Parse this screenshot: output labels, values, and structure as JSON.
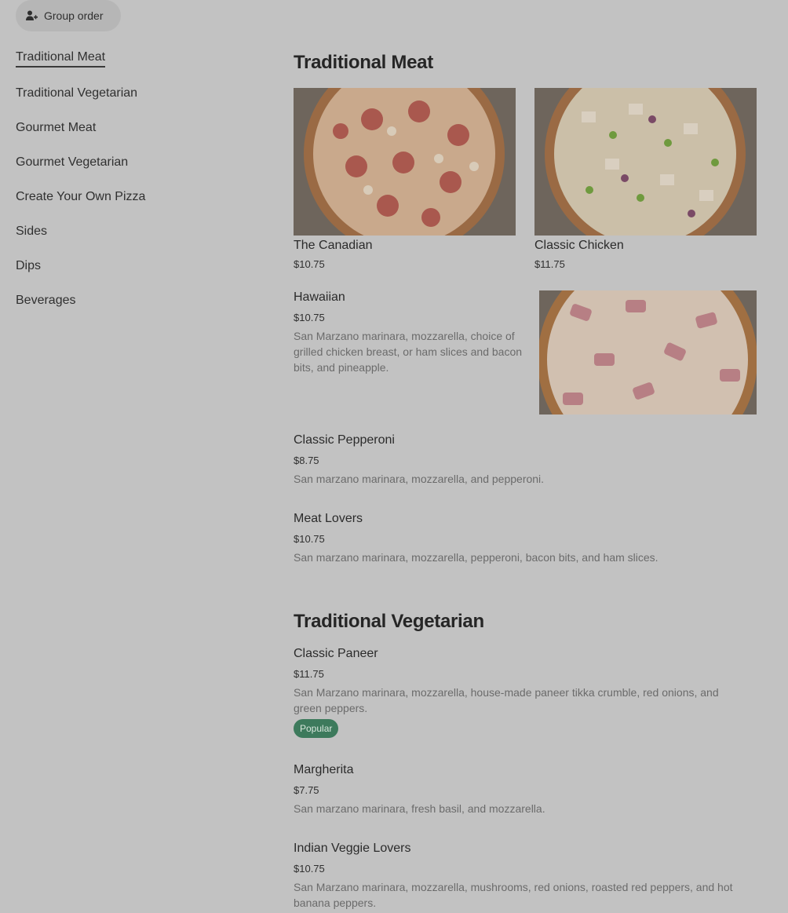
{
  "header": {
    "group_order_label": "Group order",
    "group_order_icon": "add-person-icon"
  },
  "sidebar": {
    "items": [
      {
        "label": "Traditional Meat",
        "active": true
      },
      {
        "label": "Traditional Vegetarian"
      },
      {
        "label": "Gourmet Meat"
      },
      {
        "label": "Gourmet Vegetarian"
      },
      {
        "label": "Create Your Own Pizza"
      },
      {
        "label": "Sides"
      },
      {
        "label": "Dips"
      },
      {
        "label": "Beverages"
      }
    ]
  },
  "sections": [
    {
      "title": "Traditional Meat",
      "items": [
        {
          "name": "The Canadian",
          "price": "$10.75"
        },
        {
          "name": "Classic Chicken",
          "price": "$11.75"
        },
        {
          "name": "Hawaiian",
          "price": "$10.75",
          "description": "San Marzano marinara, mozzarella, choice of grilled chicken breast, or ham slices and bacon bits, and pineapple."
        },
        {
          "name": "Classic Pepperoni",
          "price": "$8.75",
          "description": "San marzano marinara, mozzarella, and pepperoni."
        },
        {
          "name": "Meat Lovers",
          "price": "$10.75",
          "description": "San marzano marinara, mozzarella, pepperoni, bacon bits, and ham slices."
        }
      ]
    },
    {
      "title": "Traditional Vegetarian",
      "items": [
        {
          "name": "Classic Paneer",
          "price": "$11.75",
          "description": "San Marzano marinara, mozzarella, house-made paneer tikka crumble, red onions, and green peppers.",
          "badge": "Popular"
        },
        {
          "name": "Margherita",
          "price": "$7.75",
          "description": "San marzano marinara, fresh basil, and mozzarella."
        },
        {
          "name": "Indian Veggie Lovers",
          "price": "$10.75",
          "description": "San Marzano marinara, mozzarella, mushrooms, red onions, roasted red peppers, and hot banana peppers."
        }
      ]
    }
  ],
  "colors": {
    "overlay_background": "#c2c2c2",
    "badge_green": "#3d7a5c"
  }
}
